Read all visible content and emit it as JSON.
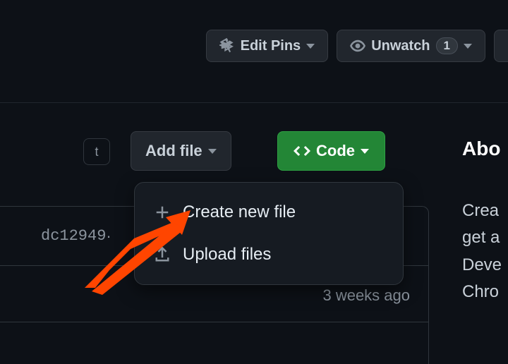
{
  "topbar": {
    "edit_pins_label": "Edit Pins",
    "unwatch_label": "Unwatch",
    "watch_count": "1"
  },
  "keyboard": {
    "t_key": "t"
  },
  "actions": {
    "add_file_label": "Add file",
    "code_label": "Code"
  },
  "about": {
    "heading": "Abo",
    "line1": "Crea",
    "line2": "get a",
    "line3": "Deve",
    "line4": "Chro"
  },
  "commit": {
    "hash": "dc12949",
    "separator": " · ",
    "time_ago": "3 weeks ago"
  },
  "dropdown": {
    "create_label": "Create new file",
    "upload_label": "Upload files"
  }
}
